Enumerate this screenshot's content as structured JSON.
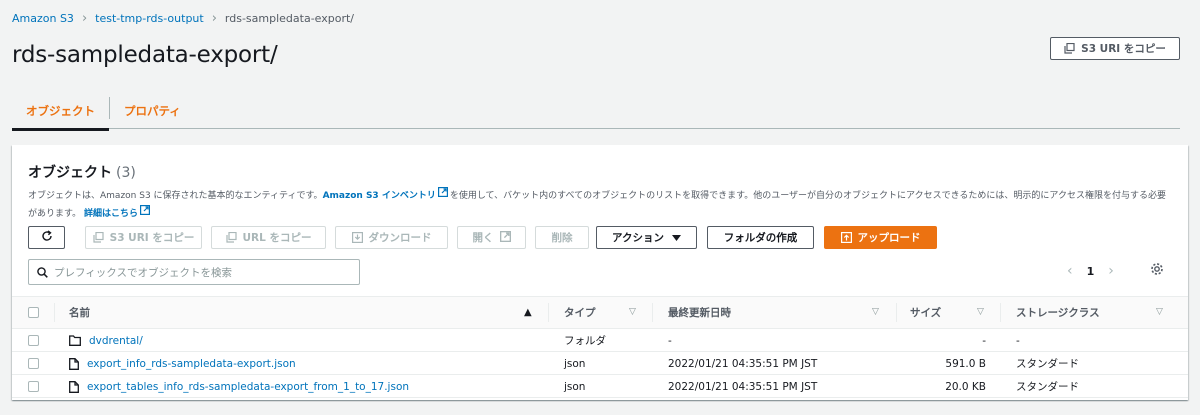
{
  "breadcrumb": {
    "items": [
      "Amazon S3",
      "test-tmp-rds-output"
    ],
    "current": "rds-sampledata-export/"
  },
  "page_title": "rds-sampledata-export/",
  "copy_uri_top": "S3 URI をコピー",
  "tabs": [
    {
      "label": "オブジェクト",
      "active": true
    },
    {
      "label": "プロパティ",
      "active": false
    }
  ],
  "panel": {
    "title": "オブジェクト",
    "count": "(3)",
    "desc_pre": "オブジェクトは、Amazon S3 に保存された基本的なエンティティです。",
    "desc_link": "Amazon S3 インベントリ",
    "desc_post": "を使用して、バケット内のすべてのオブジェクトのリストを取得できます。他のユーザーが自分のオブジェクトにアクセスできるためには、明示的にアクセス権限を付与する必要があります。",
    "desc_link2": "詳細はこちら"
  },
  "toolbar": {
    "copy_s3_uri": "S3 URI をコピー",
    "copy_url": "URL をコピー",
    "download": "ダウンロード",
    "open": "開く",
    "delete": "削除",
    "actions": "アクション",
    "create_folder": "フォルダの作成",
    "upload": "アップロード"
  },
  "search": {
    "placeholder": "プレフィックスでオブジェクトを検索"
  },
  "pager": {
    "page": "1"
  },
  "table": {
    "headers": {
      "name": "名前",
      "type": "タイプ",
      "modified": "最終更新日時",
      "size": "サイズ",
      "storage": "ストレージクラス"
    },
    "rows": [
      {
        "name": "dvdrental/",
        "kind": "folder",
        "type": "フォルダ",
        "modified": "-",
        "size": "-",
        "storage": "-"
      },
      {
        "name": "export_info_rds-sampledata-export.json",
        "kind": "file",
        "type": "json",
        "modified": "2022/01/21 04:35:51 PM JST",
        "size": "591.0 B",
        "storage": "スタンダード"
      },
      {
        "name": "export_tables_info_rds-sampledata-export_from_1_to_17.json",
        "kind": "file",
        "type": "json",
        "modified": "2022/01/21 04:35:51 PM JST",
        "size": "20.0 KB",
        "storage": "スタンダード"
      }
    ]
  },
  "colors": {
    "accent": "#ec7211",
    "link": "#0073bb",
    "text": "#16191f"
  },
  "icons": [
    "chevron-right-icon",
    "copy-icon",
    "refresh-icon",
    "download-icon",
    "external-link-icon",
    "caret-down-icon",
    "upload-icon",
    "search-icon",
    "chevron-left-icon",
    "gear-icon",
    "folder-icon",
    "file-icon",
    "sort-icon"
  ]
}
